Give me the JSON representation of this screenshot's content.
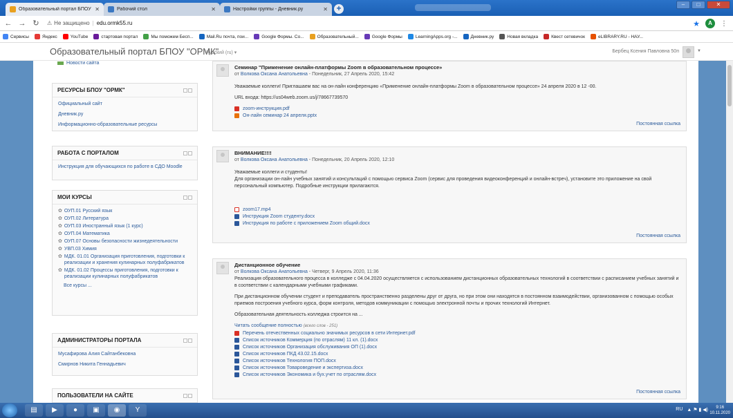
{
  "browser": {
    "tabs": [
      {
        "title": "Образовательный портал БПОУ \"ОРМК\"",
        "fav": "#e8a020"
      },
      {
        "title": "Рабочий стол",
        "fav": "#3b78c2"
      },
      {
        "title": "Настройки группы - Дневник.ру",
        "fav": "#3b78c2"
      }
    ],
    "new_tab": "+",
    "address": {
      "security": "Не защищено",
      "url": "edu.ormk55.ru"
    },
    "profile_letter": "A",
    "bookmarks": [
      {
        "label": "Сервисы",
        "color": "#4285f4"
      },
      {
        "label": "Яндекс",
        "color": "#e53935"
      },
      {
        "label": "YouTube",
        "color": "#ff0000"
      },
      {
        "label": "стартовая портал",
        "color": "#6a1b9a"
      },
      {
        "label": "Мы поможем Бесп...",
        "color": "#43a047"
      },
      {
        "label": "Mail.Ru почта, пои...",
        "color": "#1565c0"
      },
      {
        "label": "Google Формы. Со...",
        "color": "#673ab7"
      },
      {
        "label": "Образовательный...",
        "color": "#e8a020"
      },
      {
        "label": "Google Формы",
        "color": "#673ab7"
      },
      {
        "label": "LearningApps.org -...",
        "color": "#1e88e5"
      },
      {
        "label": "Дневник.ру",
        "color": "#1565c0"
      },
      {
        "label": "Новая вкладка",
        "color": "#555555"
      },
      {
        "label": "Квест сетевичок",
        "color": "#c62828"
      },
      {
        "label": "eLIBRARY.RU - НАУ...",
        "color": "#e65100"
      }
    ]
  },
  "header": {
    "site_title": "Образовательный портал БПОУ \"ОРМК\"",
    "language": "Русский (ru) ▾",
    "user_name": "Бербец Ксения Павловна 50п"
  },
  "sidebar": {
    "news_link": "Новости сайта",
    "resources": {
      "title": "РЕСУРСЫ БПОУ \"ОРМК\"",
      "links": [
        "Официальный сайт",
        "Дневник.ру",
        "Информационно-образовательные ресурсы"
      ]
    },
    "portal": {
      "title": "РАБОТА С ПОРТАЛОМ",
      "links": [
        "Инструкция для обучающихся по работе в СДО Moodle"
      ]
    },
    "courses": {
      "title": "МОИ КУРСЫ",
      "items": [
        "ОУП.01 Русский язык",
        "ОУП.02 Литература",
        "ОУП.03 Иностранный язык (1 курс)",
        "ОУП.04 Математика",
        "ОУП.07 Основы безопасности жизнедеятельности",
        "УВП.03 Химия",
        "МДК. 01.01 Организация приготовления, подготовки к реализации и хранения кулинарных полуфабрикатов",
        "МДК. 01.02 Процессы приготовления, подготовки к реализации кулинарных полуфабрикатов"
      ],
      "more": "Все курсы ..."
    },
    "admins": {
      "title": "АДМИНИСТРАТОРЫ ПОРТАЛА",
      "links": [
        "Мусафирова Алия Сайтанбековна",
        "Смирнов Никита Геннадьевич"
      ]
    },
    "users": {
      "title": "ПОЛЬЗОВАТЕЛИ НА САЙТЕ"
    }
  },
  "posts": [
    {
      "subject": "Семинар \"Применение онлайн-платформы Zoom в образовательном процессе»",
      "prefix": "от",
      "author": "Волкова Оксана Анатольевна",
      "date": "- Понедельник, 27 Апрель 2020, 15:42",
      "paragraphs": [
        "Уважаемые коллеги! Приглашаем вас на он-лайн конференцию «Применение онлайн-платформы Zoom в образовательном процессе» 24 апреля 2020 в 12 -00.",
        "URL входа: https://us04web.zoom.us/j/78667739570"
      ],
      "attachments": [
        {
          "name": "zoom-инструкция.pdf",
          "kind": "pdf"
        },
        {
          "name": "Он-лайн семинар 24 апреля.pptx",
          "kind": "ppt"
        }
      ]
    },
    {
      "subject": "ВНИМАНИЕ!!!!",
      "prefix": "от",
      "author": "Волкова Оксана Анатольевна",
      "date": "- Понедельник, 20 Апрель 2020, 12:10",
      "paragraphs": [
        "Уважаемые коллеги и студенты!",
        "Для организации он-лайн учебных занятий и консультаций с помощью сервиса Zoom (сервис для проведения видеоконференций и онлайн-встреч), установите это приложение на свой персональный компьютер. Подробные инструкции прилагаются."
      ],
      "attachments": [
        {
          "name": "zoom17.mp4",
          "kind": "mp4"
        },
        {
          "name": "Инструкция Zoom студенту.docx",
          "kind": "doc"
        },
        {
          "name": "Инструкция по работе с приложением Zoom общий.docx",
          "kind": "doc"
        }
      ]
    },
    {
      "subject": "Дистанционное обучение",
      "prefix": "от",
      "author": "Волкова Оксана Анатольевна",
      "date": "- Четверг, 9 Апрель 2020, 11:36",
      "paragraphs": [
        "Реализация образовательного процесса в колледже с 04.04.2020 осуществляется с использованием дистанционных образовательных технологий в соответствии с расписанием учебных занятий и в соответствии с календарными учебными графиками.",
        "При дистанционном обучении студент и преподаватель пространственно разделены друг от друга, но при этом они находятся в постоянном взаимодействии, организованном с помощью особых приемов построения учебного курса, форм контроля, методов коммуникации с помощью электронной почты и прочих технологий Интернет.",
        "Образовательная деятельность колледжа строится на ..."
      ],
      "read_more": "Читать сообщение полностью",
      "word_count": "(всего слов - 251)",
      "attachments": [
        {
          "name": "Перечень отечественных социально значимых ресурсов в сети Интернет.pdf",
          "kind": "pdf"
        },
        {
          "name": "Список источников Коммерция (по отраслям) 11 кл. (1).docx",
          "kind": "doc"
        },
        {
          "name": "Список источников Организация обслуживания ОП (1).docx",
          "kind": "doc"
        },
        {
          "name": "Список источников ПКД 43.02.15.docx",
          "kind": "doc"
        },
        {
          "name": "Список источников Технология ПОП.docx",
          "kind": "doc"
        },
        {
          "name": "Список источников Товароведение и экспертиза.docx",
          "kind": "doc"
        },
        {
          "name": "Список источников Экономика и бух.учет по отраслям.docx",
          "kind": "doc"
        }
      ]
    }
  ],
  "permalink": "Постоянная ссылка",
  "taskbar": {
    "tray": "RU",
    "time": "9:16",
    "date": "10.11.2020"
  }
}
